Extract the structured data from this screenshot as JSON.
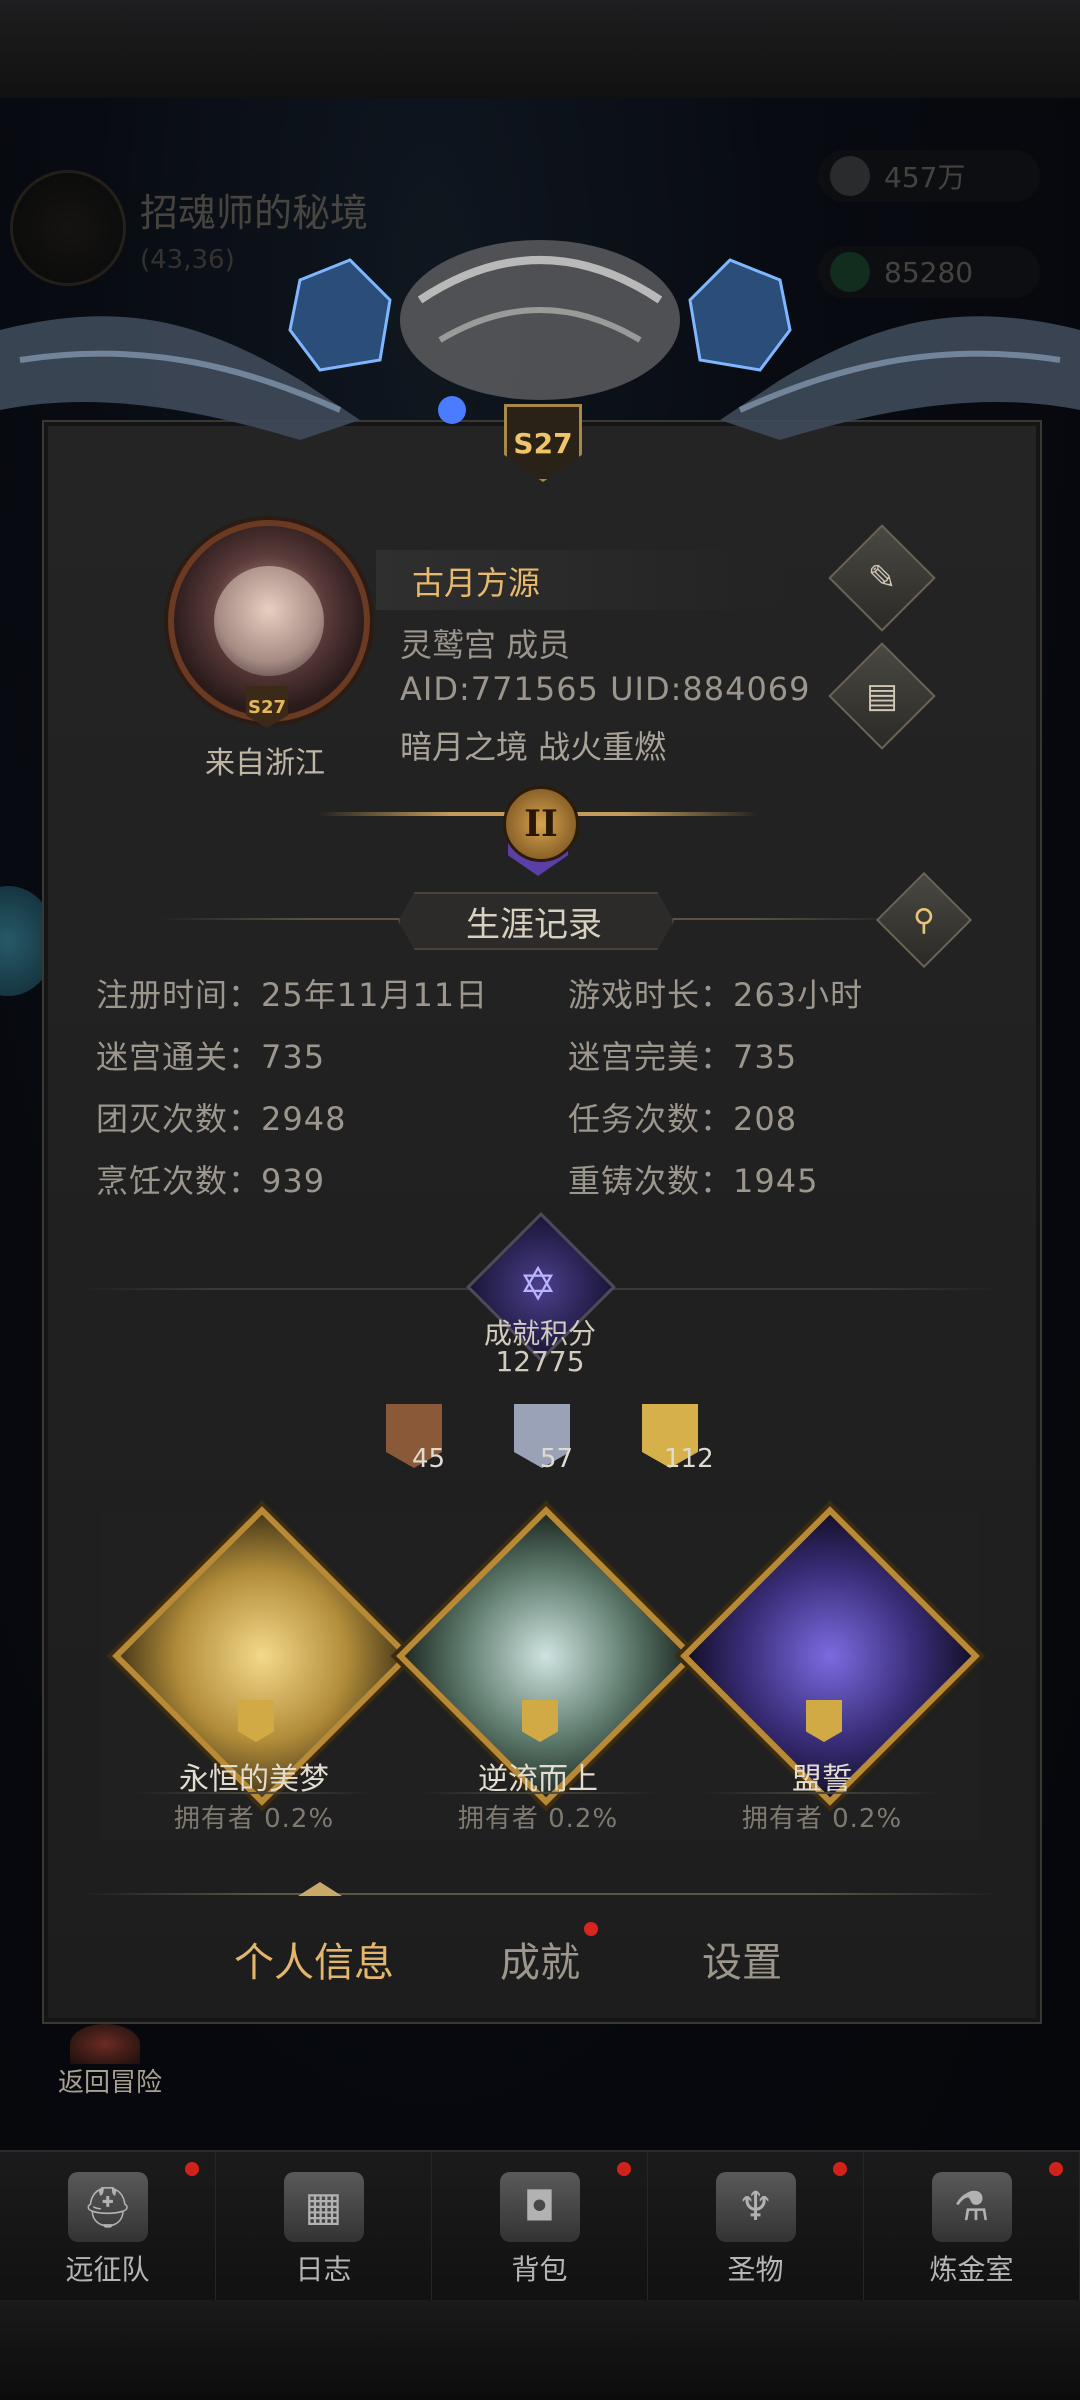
{
  "background": {
    "location_title": "招魂师的秘境",
    "location_coord": "(43,36)",
    "resource_1": "457万",
    "resource_2": "85280",
    "return_label": "返回冒险"
  },
  "season_badge": "S27",
  "profile": {
    "name": "古月方源",
    "guild": "灵鹫宫  成员",
    "ids": "AID:771565 UID:884069",
    "server": "暗月之境  战火重燃",
    "origin": "来自浙江",
    "rank": "II"
  },
  "career": {
    "section_title": "生涯记录",
    "stats_left": [
      "注册时间：25年11月11日",
      "迷宫通关：735",
      "团灭次数：2948",
      "烹饪次数：939"
    ],
    "stats_right": [
      "游戏时长：263小时",
      "迷宫完美：735",
      "任务次数：208",
      "重铸次数：1945"
    ]
  },
  "achievement": {
    "label": "成就积分",
    "score": "12775",
    "medals": [
      {
        "count": "45",
        "color": "#8a5a38"
      },
      {
        "count": "57",
        "color": "#9aa2b8"
      },
      {
        "count": "112",
        "color": "#d6b04a"
      }
    ],
    "showcase": [
      {
        "name": "永恒的美梦",
        "owner": "拥有者  0.2%",
        "color": "#d9c27a"
      },
      {
        "name": "逆流而上",
        "owner": "拥有者  0.2%",
        "color": "#6f8a7c"
      },
      {
        "name": "盟誓",
        "owner": "拥有者  0.2%",
        "color": "#4a3a8a"
      }
    ]
  },
  "tabs": [
    "个人信息",
    "成就",
    "设置"
  ],
  "bottom_nav": [
    {
      "label": "远征队",
      "icon": "helmet-icon"
    },
    {
      "label": "日志",
      "icon": "map-icon"
    },
    {
      "label": "背包",
      "icon": "backpack-icon"
    },
    {
      "label": "圣物",
      "icon": "altar-icon"
    },
    {
      "label": "炼金室",
      "icon": "alchemy-icon"
    }
  ]
}
